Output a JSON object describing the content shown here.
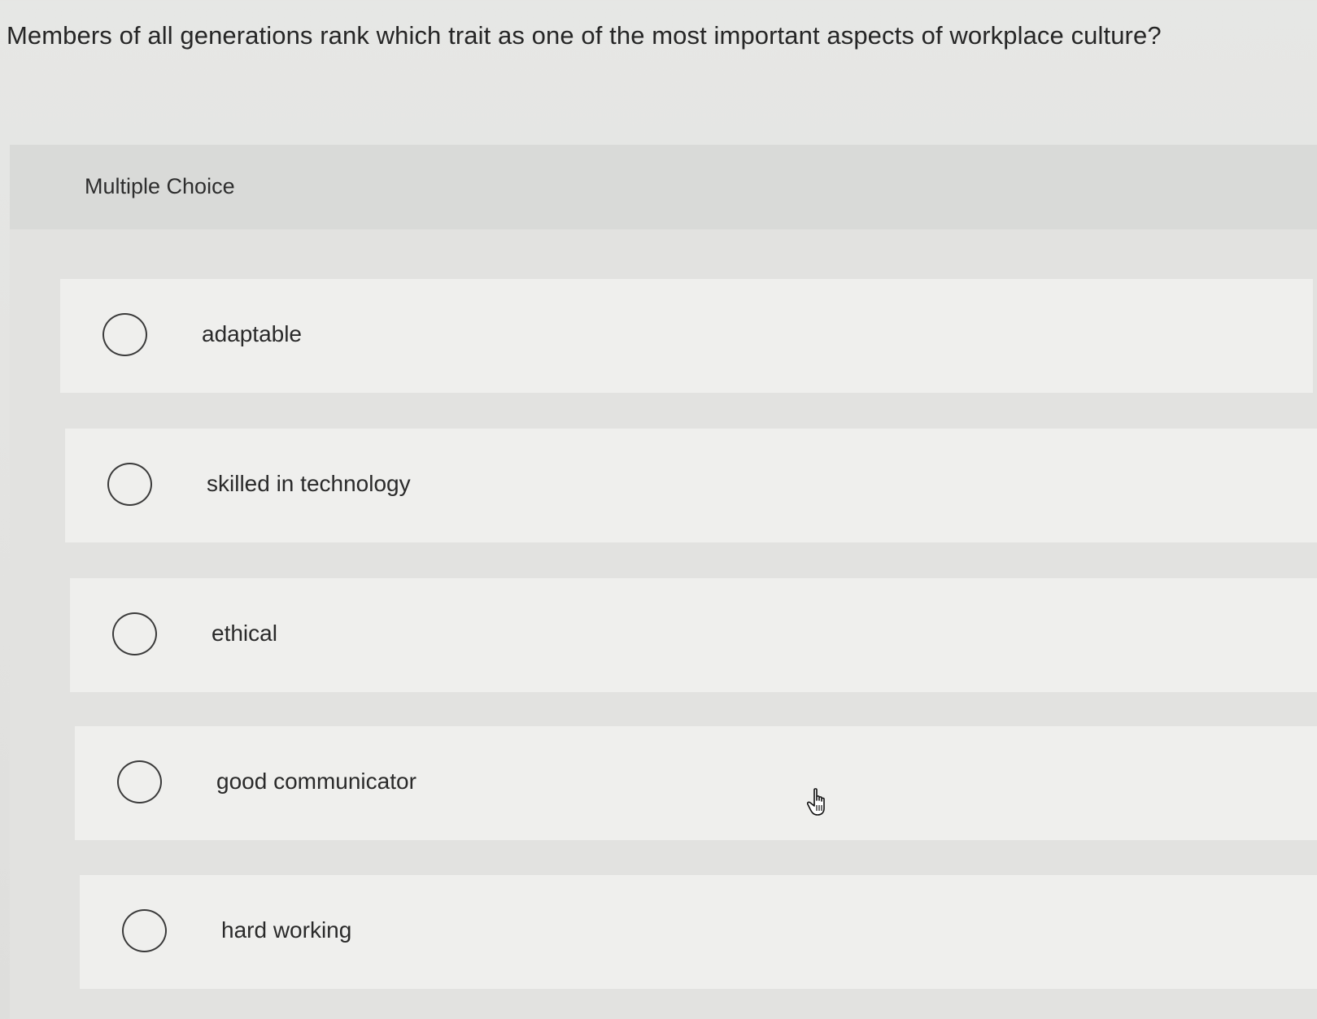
{
  "question": {
    "text": "Members of all generations rank which trait as one of the most important aspects of workplace culture?"
  },
  "panel": {
    "label": "Multiple Choice"
  },
  "options": [
    {
      "label": "adaptable",
      "selected": false
    },
    {
      "label": "skilled in technology",
      "selected": false
    },
    {
      "label": "ethical",
      "selected": false
    },
    {
      "label": "good communicator",
      "selected": false
    },
    {
      "label": "hard working",
      "selected": false
    }
  ],
  "pointer": {
    "icon": "hand-pointer-icon"
  }
}
